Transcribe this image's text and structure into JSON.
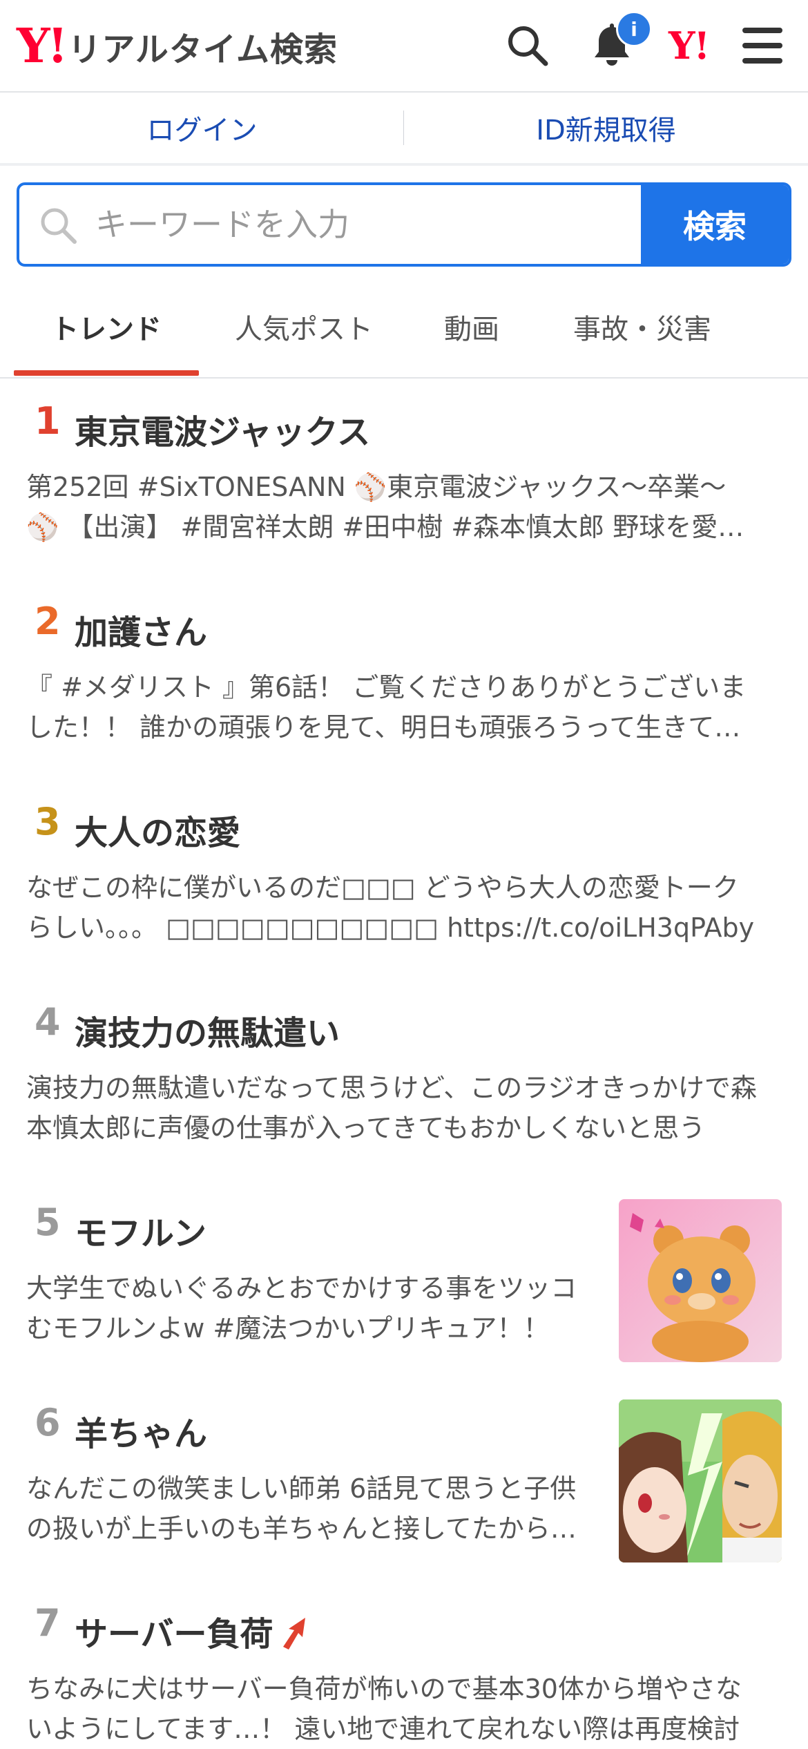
{
  "header": {
    "logo_mark": "Y!",
    "logo_text": "リアルタイム検索",
    "notification_badge": "i",
    "yjapan_mark": "Y!"
  },
  "login_bar": {
    "login_label": "ログイン",
    "register_label": "ID新規取得"
  },
  "search": {
    "placeholder": "キーワードを入力",
    "button_label": "検索"
  },
  "tabs": [
    {
      "label": "トレンド",
      "active": true
    },
    {
      "label": "人気ポスト",
      "active": false
    },
    {
      "label": "動画",
      "active": false
    },
    {
      "label": "事故・災害",
      "active": false
    }
  ],
  "colors": {
    "accent": "#1e74e8",
    "brand_red": "#ff0033",
    "rank1": "#e0412f",
    "rank2": "#ea6a2a",
    "rank3": "#c6921a",
    "rank_other": "#9a9a9a"
  },
  "trends": [
    {
      "rank": "1",
      "title": "東京電波ジャックス",
      "desc": "第252回 #SixTONESANN ⚾東京電波ジャックス〜卒業〜⚾ 【出演】 #間宮祥太朗 #田中樹 #森本慎太郎 野球を愛するすべての人へ",
      "has_thumb": false
    },
    {
      "rank": "2",
      "title": "加護さん",
      "desc": "『 #メダリスト 』第6話！ ご覧くださりありがとうございました！！ 誰かの頑張りを見て、明日も頑張ろうって生きていける",
      "has_thumb": false
    },
    {
      "rank": "3",
      "title": "大人の恋愛",
      "desc": "なぜこの枠に僕がいるのだ□□□ どうやら大人の恋愛トークらしい。。。 □□□□□□□□□□□ https://t.co/oiLH3qPAby",
      "has_thumb": false
    },
    {
      "rank": "4",
      "title": "演技力の無駄遣い",
      "desc": "演技力の無駄遣いだなって思うけど、このラジオきっかけで森本慎太郎に声優の仕事が入ってきてもおかしくないと思う",
      "has_thumb": false
    },
    {
      "rank": "5",
      "title": "モフルン",
      "desc": "大学生でぬいぐるみとおでかけする事をツッコむモフルンよw #魔法つかいプリキュア！！",
      "has_thumb": true,
      "thumb_icon": "bear-character-thumbnail"
    },
    {
      "rank": "6",
      "title": "羊ちゃん",
      "desc": "なんだこの微笑ましい師弟 6話見て思うと子供の扱いが上手いのも羊ちゃんと接してたからなのかな",
      "has_thumb": true,
      "thumb_icon": "anime-characters-thumbnail"
    },
    {
      "rank": "7",
      "title": "サーバー負荷",
      "desc": "ちなみに犬はサーバー負荷が怖いので基本30体から増やさないようにしてます…！ 遠い地で連れて戻れない際は再度検討",
      "has_thumb": false,
      "rising": true
    }
  ]
}
